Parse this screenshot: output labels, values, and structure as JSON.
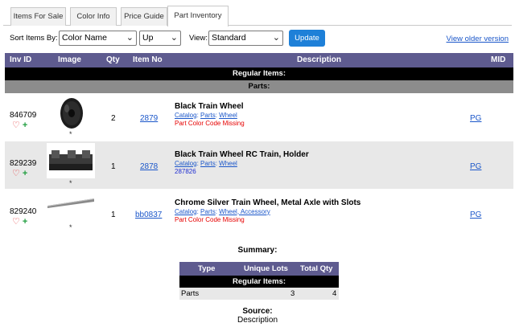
{
  "tabs": [
    "Items For Sale",
    "Color Info",
    "Price Guide",
    "Part Inventory"
  ],
  "controls": {
    "sort_label": "Sort Items By:",
    "sort_value": "Color Name",
    "order_value": "Up",
    "view_label": "View:",
    "view_value": "Standard",
    "update_label": "Update",
    "older_link": "View older version"
  },
  "table": {
    "headers": {
      "inv_id": "Inv ID",
      "image": "Image",
      "qty": "Qty",
      "item_no": "Item No",
      "description": "Description",
      "mid": "MID"
    },
    "group": "Regular Items:",
    "section": "Parts:",
    "rows": [
      {
        "inv_id": "846709",
        "qty": "2",
        "item_no": "2879",
        "title": "Black Train Wheel",
        "cat_prefix": "Catalog",
        "cat_path": "Parts",
        "cat_sub": "Wheel",
        "note": "Part Color Code Missing",
        "mid": "PG"
      },
      {
        "inv_id": "829239",
        "qty": "1",
        "item_no": "2878",
        "title": "Black Train Wheel RC Train, Holder",
        "cat_prefix": "Catalog",
        "cat_path": "Parts",
        "cat_sub": "Wheel",
        "note": "287826",
        "mid": "PG"
      },
      {
        "inv_id": "829240",
        "qty": "1",
        "item_no": "bb0837",
        "title": "Chrome Silver Train Wheel, Metal Axle with Slots",
        "cat_prefix": "Catalog",
        "cat_path": "Parts",
        "cat_sub": "Wheel, Accessory",
        "note": "Part Color Code Missing",
        "mid": "PG"
      }
    ]
  },
  "summary": {
    "title": "Summary:",
    "headers": {
      "type": "Type",
      "unique_lots": "Unique Lots",
      "total_qty": "Total Qty"
    },
    "group": "Regular Items:",
    "row": {
      "type": "Parts",
      "unique_lots": "3",
      "total_qty": "4"
    }
  },
  "source": {
    "label": "Source:",
    "value": "Description"
  },
  "icons": {
    "wanted": "heart-icon",
    "add": "plus-icon",
    "dropdown": "chevron-down-icon"
  }
}
